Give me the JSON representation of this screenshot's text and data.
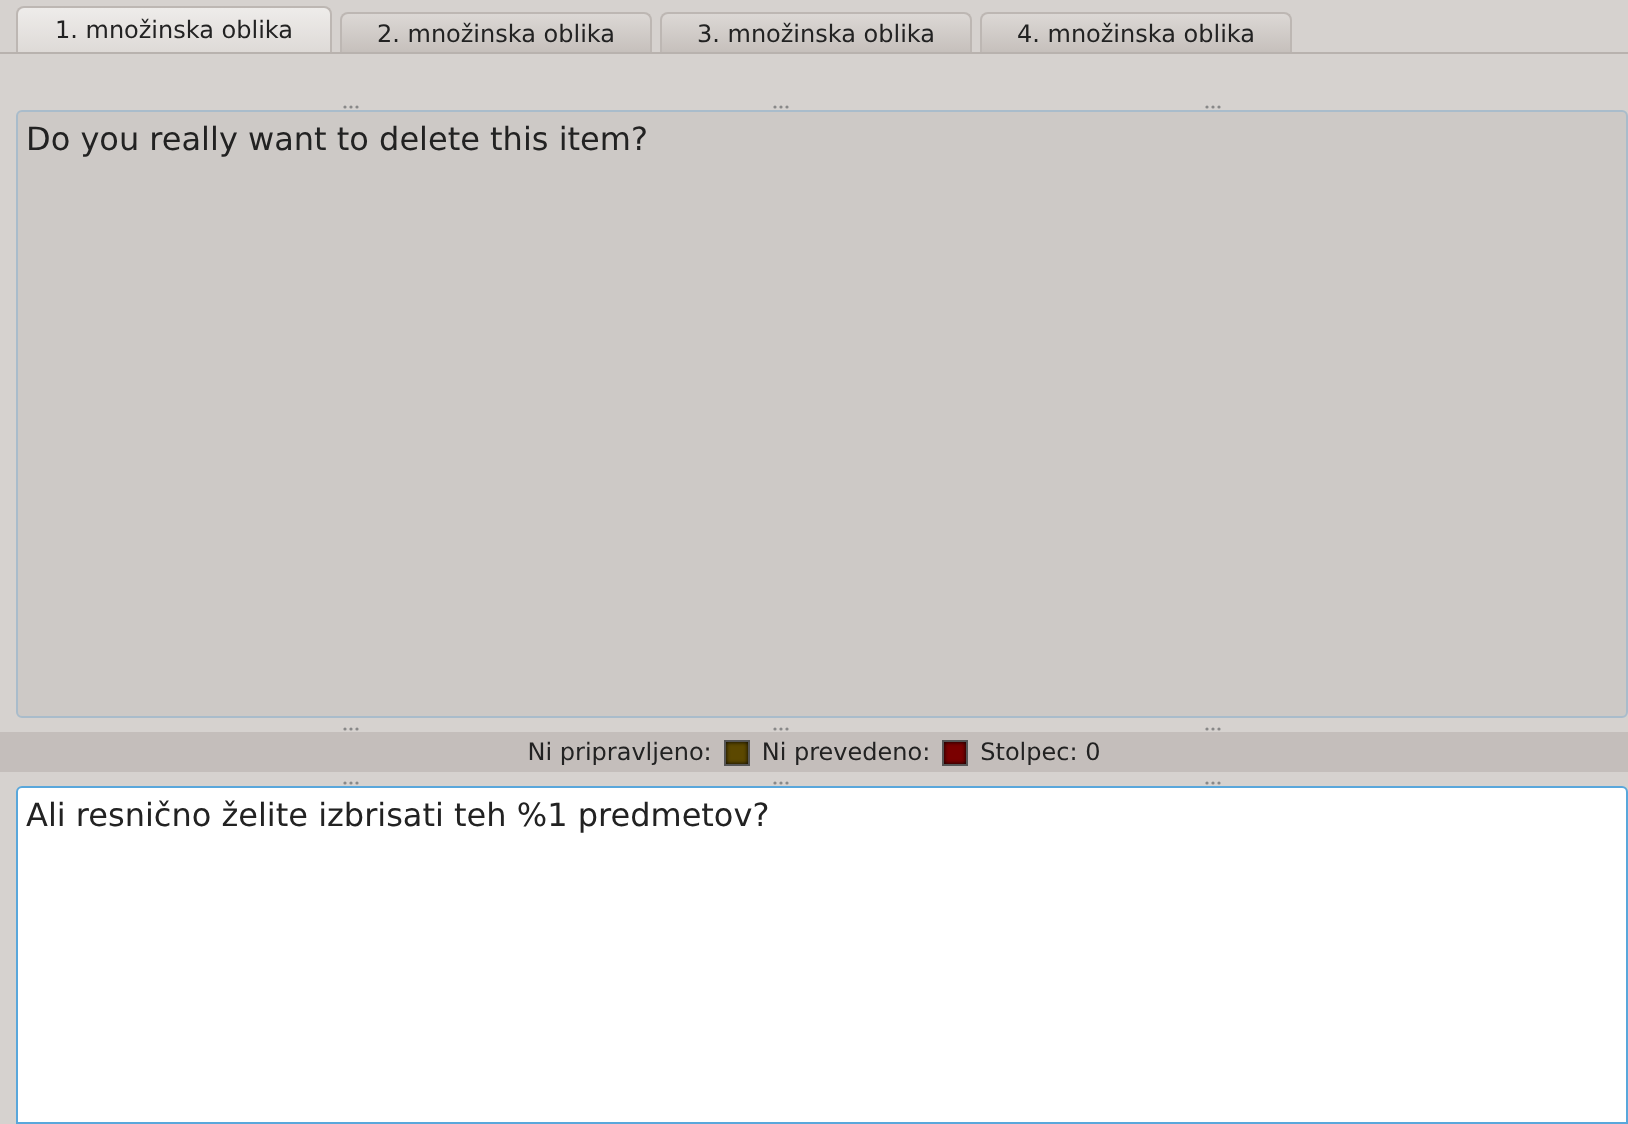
{
  "tabs": [
    {
      "label": "1. množinska oblika",
      "selected": true
    },
    {
      "label": "2. množinska oblika",
      "selected": false
    },
    {
      "label": "3. množinska oblika",
      "selected": false
    },
    {
      "label": "4. množinska oblika",
      "selected": false
    }
  ],
  "source": {
    "text": "Do you really want to delete this item?"
  },
  "status": [
    {
      "label": "Ni pripravljeno:",
      "color": "#5c4800"
    },
    {
      "label": "Ni prevedeno:",
      "color": "#7a0000"
    },
    {
      "label": "Stolpec: 0"
    }
  ],
  "translation": {
    "value": "Ali resnično želite izbrisati teh %1 predmetov?"
  }
}
